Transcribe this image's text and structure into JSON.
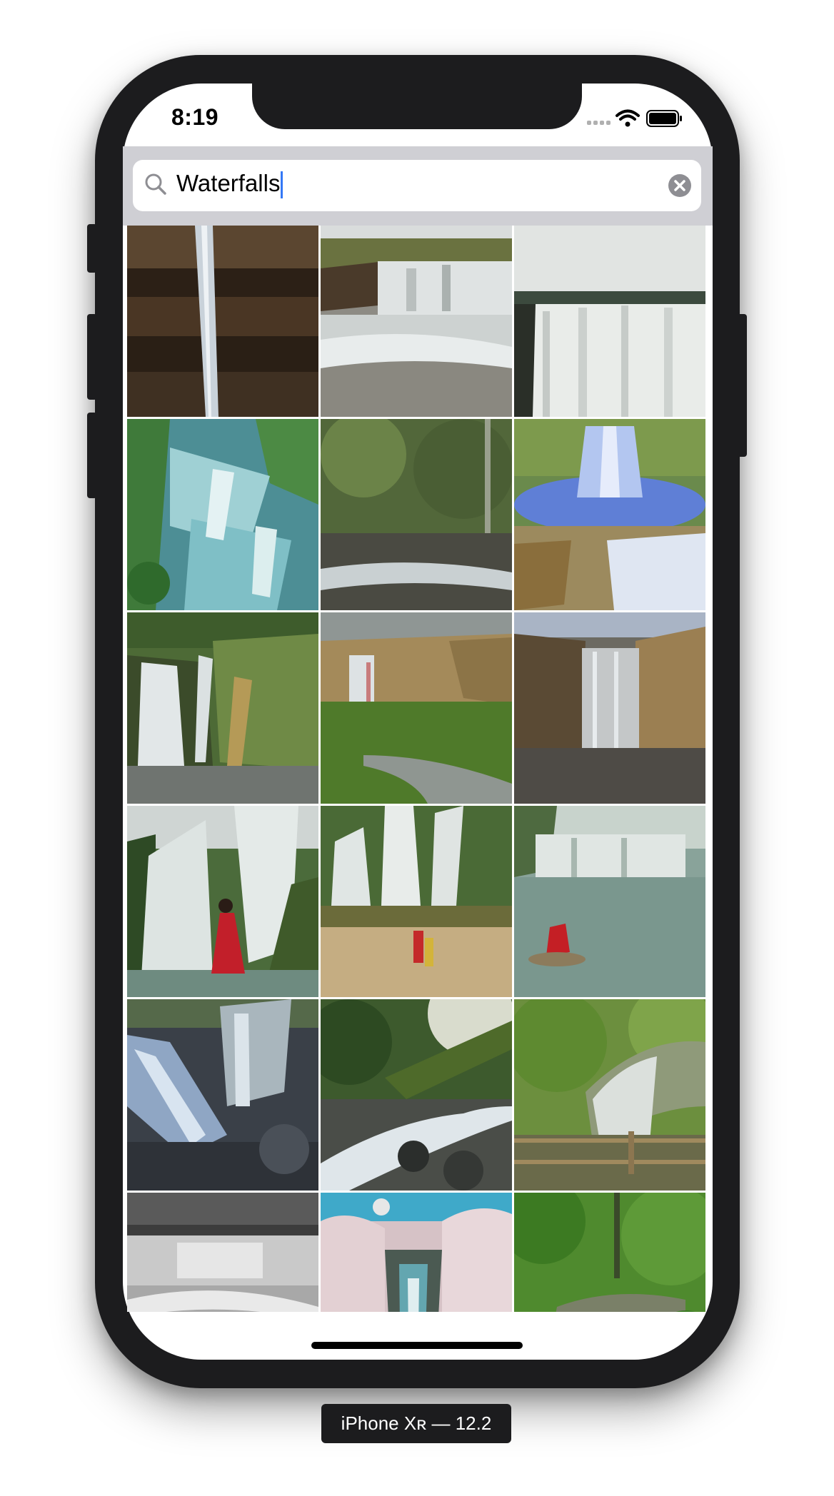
{
  "status_bar": {
    "time": "8:19"
  },
  "search": {
    "value": "Waterfalls"
  },
  "device_label": "iPhone Xʀ — 12.2",
  "icons": {
    "search": "search-icon",
    "clear": "clear-icon",
    "wifi": "wifi-icon",
    "battery": "battery-icon",
    "cellular": "cellular-signal-icon"
  },
  "colors": {
    "frame": "#1c1c1e",
    "search_bar_background": "#cfcfd4",
    "caret": "#3478f6"
  },
  "results": [
    {
      "theme": "thin-waterfall-cliff"
    },
    {
      "theme": "river-cascade"
    },
    {
      "theme": "wide-falls-grey-sky"
    },
    {
      "theme": "teal-tiered-falls"
    },
    {
      "theme": "forest-stream"
    },
    {
      "theme": "blue-fountain-falls"
    },
    {
      "theme": "green-cliff-falls"
    },
    {
      "theme": "falls-green-valley"
    },
    {
      "theme": "falls-brown-cliffs"
    },
    {
      "theme": "falls-person-red-dress"
    },
    {
      "theme": "falls-family-beach"
    },
    {
      "theme": "falls-lake-person"
    },
    {
      "theme": "rocky-blue-cascade"
    },
    {
      "theme": "jungle-river"
    },
    {
      "theme": "mossy-falls-fence"
    },
    {
      "theme": "bw-river-falls"
    },
    {
      "theme": "cherry-blossom-creek"
    },
    {
      "theme": "green-forest-stream"
    }
  ]
}
